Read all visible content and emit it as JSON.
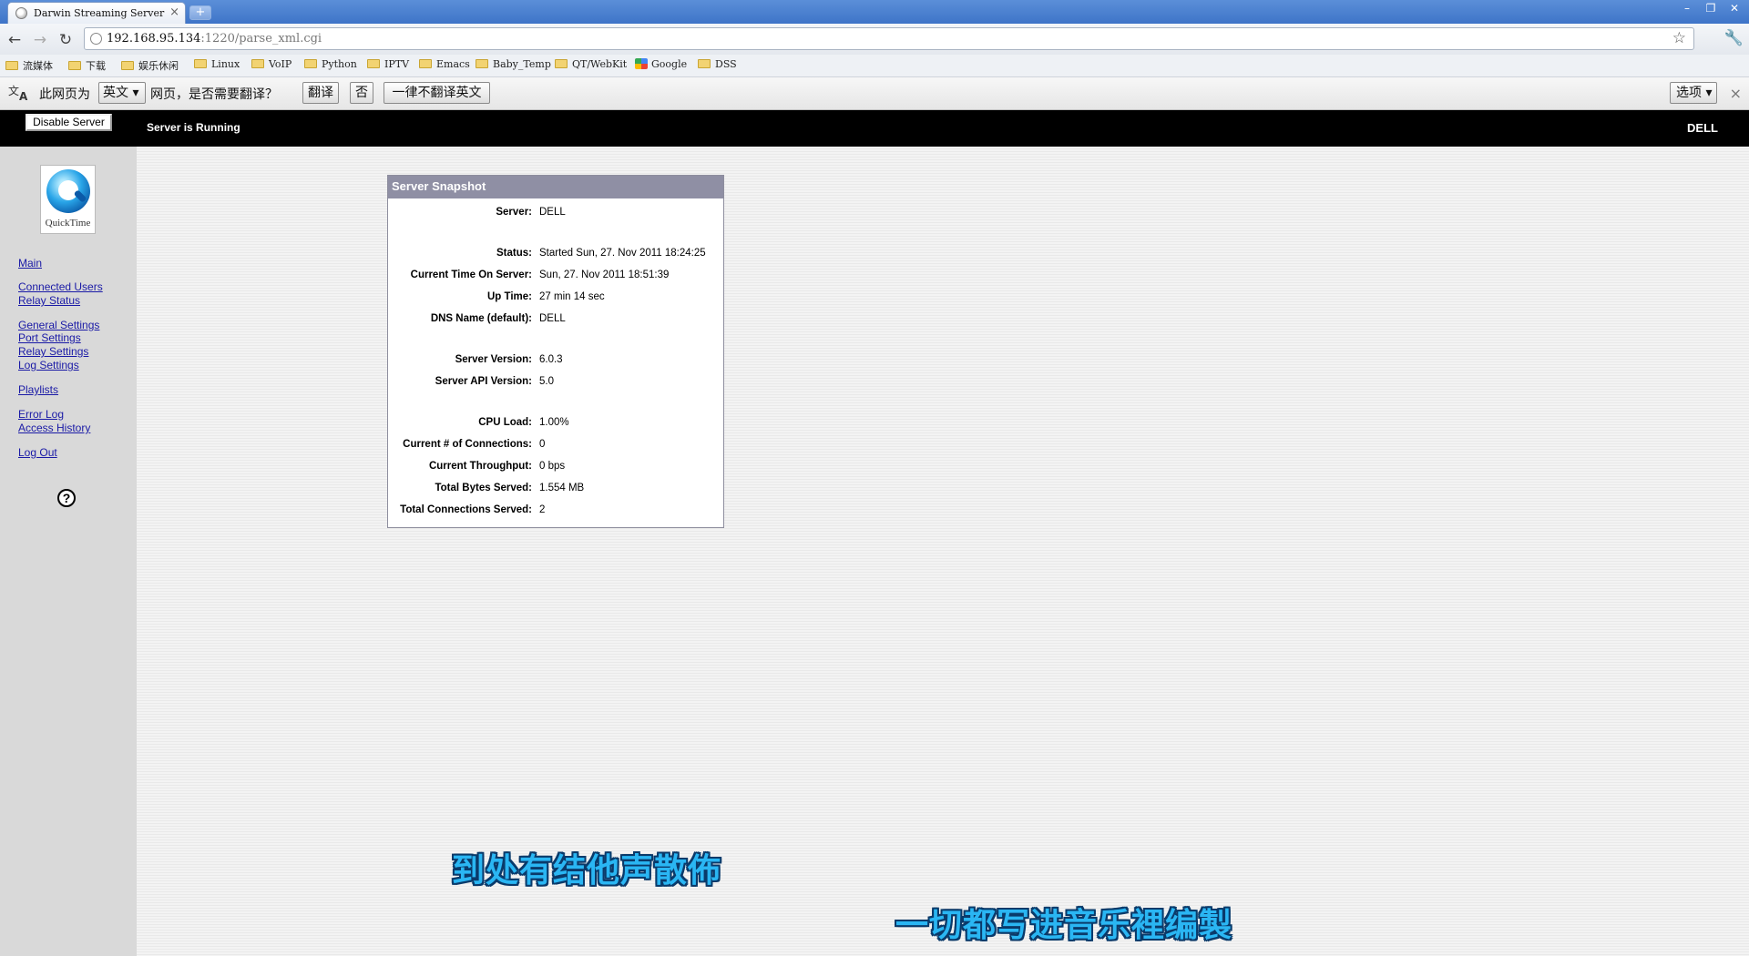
{
  "browser": {
    "tab_title": "Darwin Streaming Server",
    "tab_close": "×",
    "new_tab": "+",
    "window_controls": {
      "minimize": "–",
      "maximize": "❐",
      "close": "✕"
    },
    "nav": {
      "back": "←",
      "forward": "→",
      "reload": "↻"
    },
    "url_host": "192.168.95.134",
    "url_rest": ":1220/parse_xml.cgi",
    "star": "☆",
    "wrench": "🔧",
    "bookmarks": [
      "流媒体",
      "下载",
      "娱乐休闲",
      "Linux",
      "VoIP",
      "Python",
      "IPTV",
      "Emacs",
      "Baby_Temp",
      "QT/WebKit",
      "Google",
      "DSS"
    ]
  },
  "translate_bar": {
    "icon_a": "文",
    "icon_b": "A",
    "prefix": "此网页为",
    "language": "英文",
    "question": "网页，是否需要翻译？",
    "translate_btn": "翻译",
    "no_btn": "否",
    "never_btn": "一律不翻译英文",
    "options_btn": "选项",
    "close": "×"
  },
  "page": {
    "disable_button": "Disable Server",
    "server_status": "Server is Running",
    "server_name": "DELL",
    "logo_label": "QuickTime",
    "help": "?",
    "sidebar_links": [
      "Main",
      "Connected Users",
      "Relay Status",
      "General Settings",
      "Port Settings",
      "Relay Settings",
      "Log Settings",
      "Playlists",
      "Error Log",
      "Access History",
      "Log Out"
    ],
    "snapshot": {
      "title": "Server Snapshot",
      "rows": [
        {
          "k": "Server:",
          "v": "DELL"
        },
        {
          "k": "Status:",
          "v": "Started Sun, 27. Nov 2011 18:24:25"
        },
        {
          "k": "Current Time On Server:",
          "v": "Sun, 27. Nov 2011 18:51:39"
        },
        {
          "k": "Up Time:",
          "v": "27 min 14 sec"
        },
        {
          "k": "DNS Name (default):",
          "v": "DELL"
        },
        {
          "k": "Server Version:",
          "v": "6.0.3"
        },
        {
          "k": "Server API Version:",
          "v": "5.0"
        },
        {
          "k": "CPU Load:",
          "v": "1.00%"
        },
        {
          "k": "Current # of Connections:",
          "v": "0"
        },
        {
          "k": "Current Throughput:",
          "v": "0 bps"
        },
        {
          "k": "Total Bytes Served:",
          "v": "1.554 MB"
        },
        {
          "k": "Total Connections Served:",
          "v": "2"
        }
      ]
    }
  },
  "subtitles": {
    "line1": "到处有结他声散佈",
    "line2": "一切都写进音乐裡编製"
  }
}
